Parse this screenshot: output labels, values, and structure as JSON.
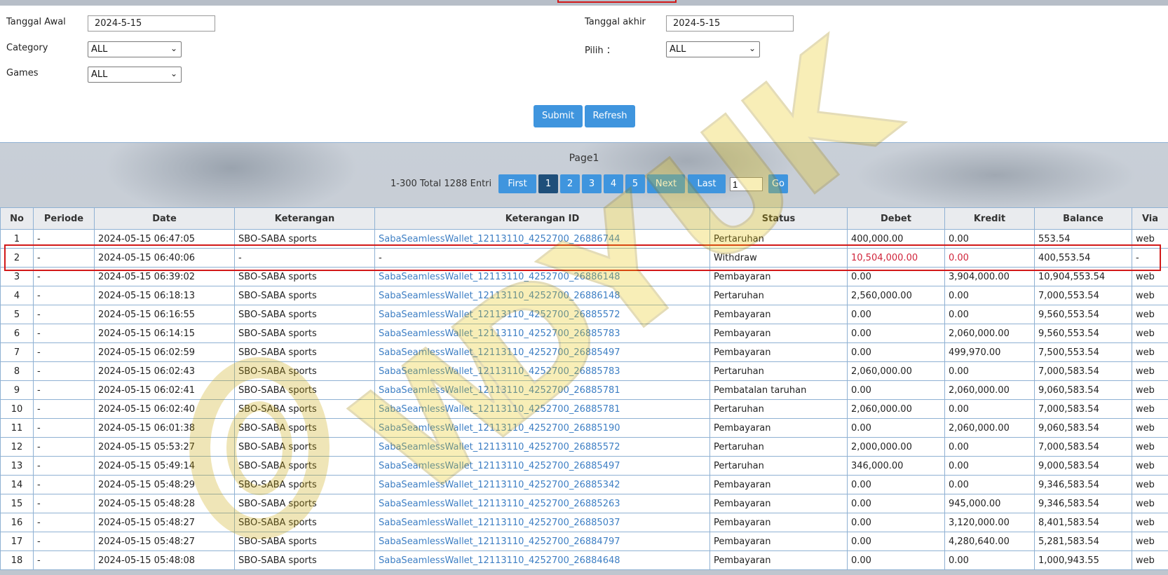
{
  "filters": {
    "start_date_label": "Tanggal Awal",
    "start_date_value": "2024-5-15",
    "end_date_label": "Tanggal akhir",
    "end_date_value": "2024-5-15",
    "category_label": "Category",
    "category_value": "ALL",
    "pilih_label": "Pilih ：",
    "pilih_value": "ALL",
    "games_label": "Games",
    "games_value": "ALL",
    "submit_label": "Submit",
    "refresh_label": "Refresh"
  },
  "pager": {
    "title": "Page1",
    "range_text": "1-300 Total 1288 Entri",
    "first_label": "First",
    "pages": [
      "1",
      "2",
      "3",
      "4",
      "5"
    ],
    "active_page": "1",
    "next_label": "Next",
    "last_label": "Last",
    "goto_value": "1",
    "go_label": "Go"
  },
  "table": {
    "headers": [
      "No",
      "Periode",
      "Date",
      "Keterangan",
      "Keterangan ID",
      "Status",
      "Debet",
      "Kredit",
      "Balance",
      "Via"
    ],
    "rows": [
      [
        "1",
        "-",
        "2024-05-15 06:47:05",
        "SBO-SABA sports",
        "SabaSeamlessWallet_12113110_4252700_26886744",
        "Pertaruhan",
        "400,000.00",
        "0.00",
        "553.54",
        "web"
      ],
      [
        "2",
        "-",
        "2024-05-15 06:40:06",
        "-",
        "-",
        "Withdraw",
        "10,504,000.00",
        "0.00",
        "400,553.54",
        "-"
      ],
      [
        "3",
        "-",
        "2024-05-15 06:39:02",
        "SBO-SABA sports",
        "SabaSeamlessWallet_12113110_4252700_26886148",
        "Pembayaran",
        "0.00",
        "3,904,000.00",
        "10,904,553.54",
        "web"
      ],
      [
        "4",
        "-",
        "2024-05-15 06:18:13",
        "SBO-SABA sports",
        "SabaSeamlessWallet_12113110_4252700_26886148",
        "Pertaruhan",
        "2,560,000.00",
        "0.00",
        "7,000,553.54",
        "web"
      ],
      [
        "5",
        "-",
        "2024-05-15 06:16:55",
        "SBO-SABA sports",
        "SabaSeamlessWallet_12113110_4252700_26885572",
        "Pembayaran",
        "0.00",
        "0.00",
        "9,560,553.54",
        "web"
      ],
      [
        "6",
        "-",
        "2024-05-15 06:14:15",
        "SBO-SABA sports",
        "SabaSeamlessWallet_12113110_4252700_26885783",
        "Pembayaran",
        "0.00",
        "2,060,000.00",
        "9,560,553.54",
        "web"
      ],
      [
        "7",
        "-",
        "2024-05-15 06:02:59",
        "SBO-SABA sports",
        "SabaSeamlessWallet_12113110_4252700_26885497",
        "Pembayaran",
        "0.00",
        "499,970.00",
        "7,500,553.54",
        "web"
      ],
      [
        "8",
        "-",
        "2024-05-15 06:02:43",
        "SBO-SABA sports",
        "SabaSeamlessWallet_12113110_4252700_26885783",
        "Pertaruhan",
        "2,060,000.00",
        "0.00",
        "7,000,583.54",
        "web"
      ],
      [
        "9",
        "-",
        "2024-05-15 06:02:41",
        "SBO-SABA sports",
        "SabaSeamlessWallet_12113110_4252700_26885781",
        "Pembatalan taruhan",
        "0.00",
        "2,060,000.00",
        "9,060,583.54",
        "web"
      ],
      [
        "10",
        "-",
        "2024-05-15 06:02:40",
        "SBO-SABA sports",
        "SabaSeamlessWallet_12113110_4252700_26885781",
        "Pertaruhan",
        "2,060,000.00",
        "0.00",
        "7,000,583.54",
        "web"
      ],
      [
        "11",
        "-",
        "2024-05-15 06:01:38",
        "SBO-SABA sports",
        "SabaSeamlessWallet_12113110_4252700_26885190",
        "Pembayaran",
        "0.00",
        "2,060,000.00",
        "9,060,583.54",
        "web"
      ],
      [
        "12",
        "-",
        "2024-05-15 05:53:27",
        "SBO-SABA sports",
        "SabaSeamlessWallet_12113110_4252700_26885572",
        "Pertaruhan",
        "2,000,000.00",
        "0.00",
        "7,000,583.54",
        "web"
      ],
      [
        "13",
        "-",
        "2024-05-15 05:49:14",
        "SBO-SABA sports",
        "SabaSeamlessWallet_12113110_4252700_26885497",
        "Pertaruhan",
        "346,000.00",
        "0.00",
        "9,000,583.54",
        "web"
      ],
      [
        "14",
        "-",
        "2024-05-15 05:48:29",
        "SBO-SABA sports",
        "SabaSeamlessWallet_12113110_4252700_26885342",
        "Pembayaran",
        "0.00",
        "0.00",
        "9,346,583.54",
        "web"
      ],
      [
        "15",
        "-",
        "2024-05-15 05:48:28",
        "SBO-SABA sports",
        "SabaSeamlessWallet_12113110_4252700_26885263",
        "Pembayaran",
        "0.00",
        "945,000.00",
        "9,346,583.54",
        "web"
      ],
      [
        "16",
        "-",
        "2024-05-15 05:48:27",
        "SBO-SABA sports",
        "SabaSeamlessWallet_12113110_4252700_26885037",
        "Pembayaran",
        "0.00",
        "3,120,000.00",
        "8,401,583.54",
        "web"
      ],
      [
        "17",
        "-",
        "2024-05-15 05:48:27",
        "SBO-SABA sports",
        "SabaSeamlessWallet_12113110_4252700_26884797",
        "Pembayaran",
        "0.00",
        "4,280,640.00",
        "5,281,583.54",
        "web"
      ],
      [
        "18",
        "-",
        "2024-05-15 05:48:08",
        "SBO-SABA sports",
        "SabaSeamlessWallet_12113110_4252700_26884648",
        "Pembayaran",
        "0.00",
        "0.00",
        "1,000,943.55",
        "web"
      ]
    ],
    "highlighted_row": 2
  },
  "watermark": {
    "text": "WDYUK",
    "color": "#e8c400"
  },
  "colors": {
    "accent": "#3f95de",
    "link": "#3e7fc4",
    "alert": "#d0243a",
    "mark": "#d21919"
  }
}
